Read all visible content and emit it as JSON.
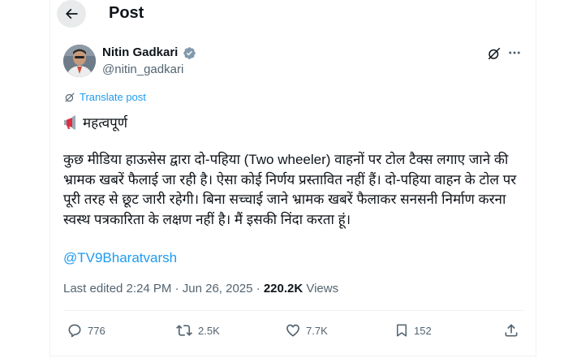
{
  "header": {
    "title": "Post"
  },
  "author": {
    "name": "Nitin Gadkari",
    "handle": "@nitin_gadkari"
  },
  "translate_label": "Translate post",
  "post": {
    "headline": "महत्वपूर्ण",
    "body": "कुछ मीडिया हाऊसेस  द्वारा दो-पहिया (Two wheeler) वाहनों पर टोल टैक्स लगाए जाने की भ्रामक खबरें फैलाई जा रही है। ऐसा कोई निर्णय प्रस्तावित नहीं हैं। दो-पहिया वाहन के टोल पर पूरी तरह से छूट जारी रहेगी। बिना सच्चाई जाने भ्रामक खबरें फैलाकर सनसनी निर्माण करना स्वस्थ पत्रकारिता के लक्षण नहीं है। मैं इसकी निंदा करता हूं।",
    "mention": "@TV9Bharatvarsh"
  },
  "meta": {
    "edited": "Last edited 2:24 PM · Jun 26, 2025 · ",
    "views_count": "220.2K",
    "views_label": " Views"
  },
  "actions": {
    "replies": "776",
    "reposts": "2.5K",
    "likes": "7.7K",
    "bookmarks": "152"
  },
  "colors": {
    "accent": "#1d9bf0",
    "muted": "#536471",
    "text": "#0f1419",
    "verified": "#829aab",
    "megaphone": "#dd2e44"
  },
  "icons": [
    "back-arrow-icon",
    "verified-badge-icon",
    "grok-icon",
    "more-icon",
    "translate-icon",
    "megaphone-icon",
    "reply-icon",
    "repost-icon",
    "like-icon",
    "bookmark-icon",
    "share-icon"
  ]
}
